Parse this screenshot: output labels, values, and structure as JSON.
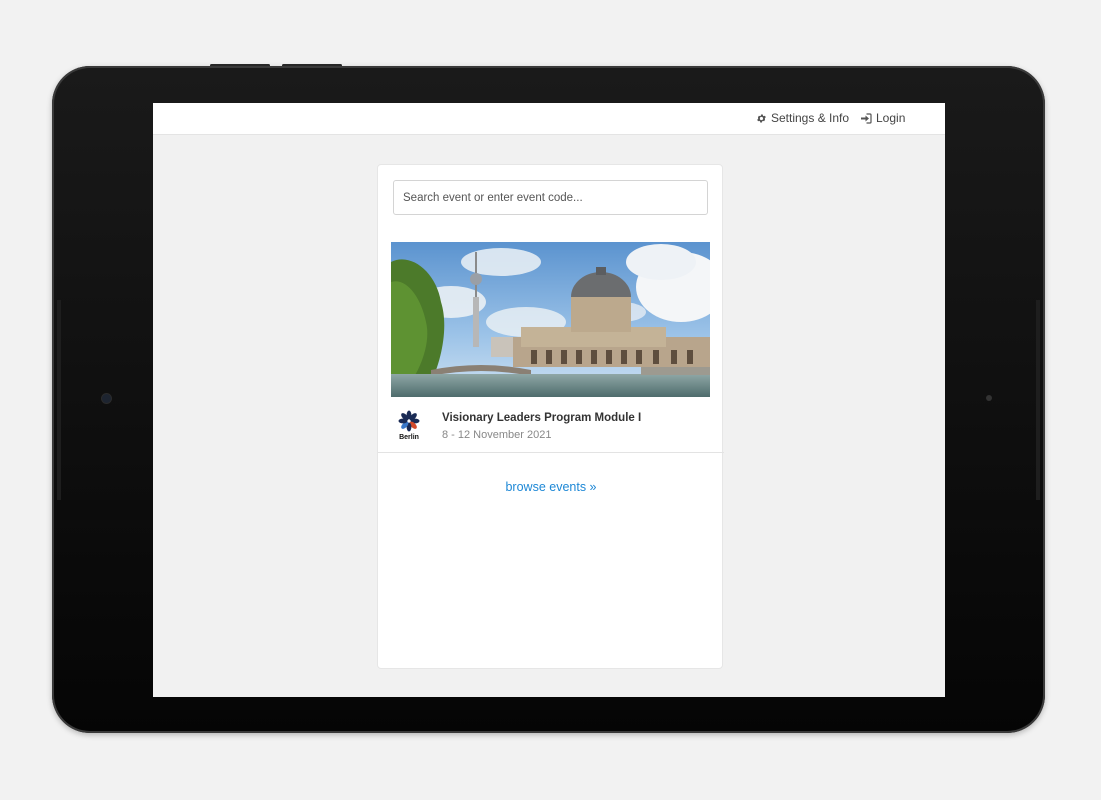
{
  "topbar": {
    "settings_label": "Settings & Info",
    "login_label": "Login"
  },
  "search": {
    "placeholder": "Search event or enter event code..."
  },
  "event": {
    "title": "Visionary Leaders Program Module I",
    "date": "8 - 12 November 2021",
    "logo_text": "Berlin"
  },
  "browse_label": "browse events »",
  "colors": {
    "link": "#1e88d6",
    "background": "#f1f1f1",
    "card": "#ffffff"
  }
}
